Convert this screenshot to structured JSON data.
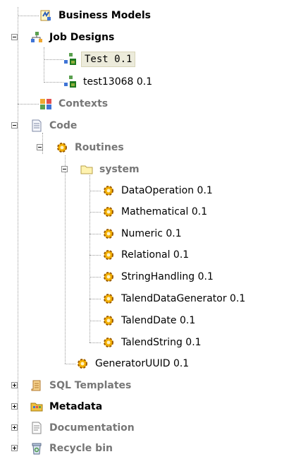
{
  "tree": {
    "business_models": "Business Models",
    "job_designs": "Job Designs",
    "job_test": "Test 0.1",
    "job_test13068": "test13068 0.1",
    "contexts": "Contexts",
    "code": "Code",
    "routines": "Routines",
    "system": "system",
    "system_routines": [
      "DataOperation 0.1",
      "Mathematical 0.1",
      "Numeric 0.1",
      "Relational 0.1",
      "StringHandling 0.1",
      "TalendDataGenerator 0.1",
      "TalendDate 0.1",
      "TalendString 0.1"
    ],
    "generator_uuid": "GeneratorUUID 0.1",
    "sql_templates": "SQL Templates",
    "metadata": "Metadata",
    "documentation": "Documentation",
    "recycle_bin": "Recycle bin"
  },
  "colors": {
    "selection": "#ecebdb",
    "gray_text": "#777777",
    "guide": "#9a9a9a"
  }
}
